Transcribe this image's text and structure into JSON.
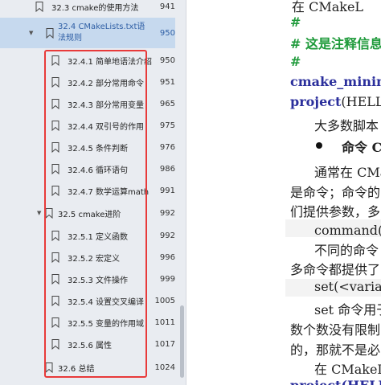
{
  "bookmarks": [
    {
      "label": "32.3 cmake的使用方法",
      "page": "941"
    },
    {
      "label": "32.4 CMakeLists.txt语法规则",
      "page": "950"
    },
    {
      "label": "32.4.1 简单地语法介绍",
      "page": "950"
    },
    {
      "label": "32.4.2 部分常用命令",
      "page": "951"
    },
    {
      "label": "32.4.3 部分常用变量",
      "page": "965"
    },
    {
      "label": "32.4.4 双引号的作用",
      "page": "975"
    },
    {
      "label": "32.4.5 条件判断",
      "page": "976"
    },
    {
      "label": "32.4.6 循环语句",
      "page": "986"
    },
    {
      "label": "32.4.7 数学运算math",
      "page": "991"
    },
    {
      "label": "32.5 cmake进阶",
      "page": "992"
    },
    {
      "label": "32.5.1 定义函数",
      "page": "992"
    },
    {
      "label": "32.5.2 宏定义",
      "page": "996"
    },
    {
      "label": "32.5.3 文件操作",
      "page": "999"
    },
    {
      "label": "32.5.4 设置交叉编译",
      "page": "1005"
    },
    {
      "label": "32.5.5 变量的作用域",
      "page": "1011"
    },
    {
      "label": "32.5.6 属性",
      "page": "1017"
    },
    {
      "label": "32.6 总结",
      "page": "1024"
    }
  ],
  "document": {
    "l1": "在 CMakeL",
    "l2": "#",
    "l3": "# 这是注释信息",
    "l4": "#",
    "l5": "cmake_minimum",
    "l6a": "project",
    "l6b": "(HELLO)",
    "l7": "大多数脚本",
    "l8": "命令 C",
    "l9": "通常在 CMa",
    "l10": "是命令；命令的",
    "l11": "们提供参数，多",
    "l12": "command(参",
    "l13": "不同的命令",
    "l14": "多命令都提供了",
    "l15": "set(<variable",
    "l16": "set 命令用于",
    "l17": "数个数没有限制",
    "l18": "的，那就不是必",
    "l19": "在 CMakeL",
    "l20": "project(HELLO)"
  }
}
